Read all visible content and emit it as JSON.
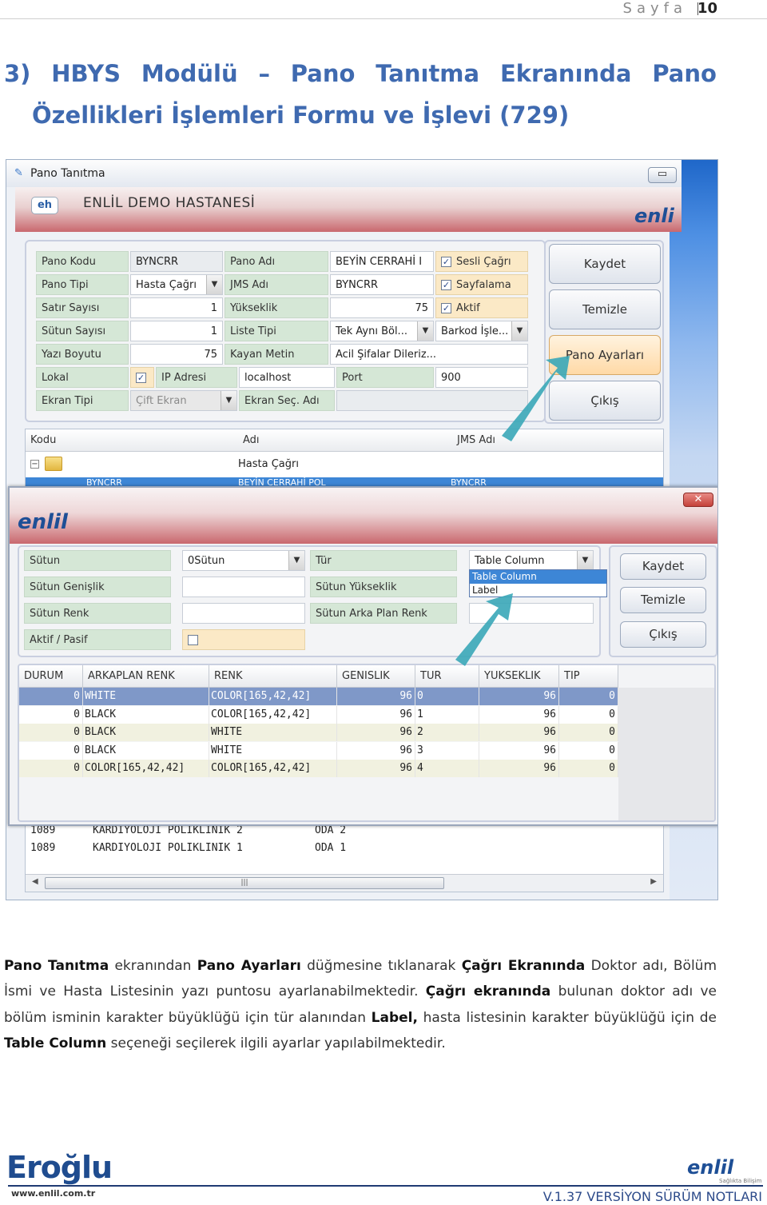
{
  "page": {
    "label": "Sayfa",
    "number": "10"
  },
  "heading": {
    "line1": [
      "3)",
      "HBYS",
      "Modülü",
      "–",
      "Pano",
      "Tanıtma",
      "Ekranında",
      "Pano"
    ],
    "line2": "Özellikleri İşlemleri Formu ve İşlevi (729)"
  },
  "screenshot": {
    "window_title": "Pano Tanıtma",
    "min_button": "▭",
    "banner": {
      "badge": "eh",
      "hospital": "ENLİL DEMO HASTANESİ",
      "logo": "enli"
    },
    "form": {
      "pano_kodu_label": "Pano Kodu",
      "pano_kodu": "BYNCRR",
      "pano_adi_label": "Pano Adı",
      "pano_adi": "BEYİN CERRAHİ I",
      "sesli_cagri": "Sesli Çağrı",
      "pano_tipi_label": "Pano Tipi",
      "pano_tipi": "Hasta Çağrı",
      "jms_adi_label": "JMS Adı",
      "jms_adi": "BYNCRR",
      "sayfalama": "Sayfalama",
      "satir_sayisi_label": "Satır Sayısı",
      "satir_sayisi": "1",
      "yukseklik_label": "Yükseklik",
      "yukseklik": "75",
      "aktif": "Aktif",
      "sutun_sayisi_label": "Sütun Sayısı",
      "sutun_sayisi": "1",
      "liste_tipi_label": "Liste Tipi",
      "liste_tipi": "Tek Aynı Böl...",
      "barkod": "Barkod İşle...",
      "yazi_boyutu_label": "Yazı Boyutu",
      "yazi_boyutu": "75",
      "kayan_metin_label": "Kayan Metin",
      "kayan_metin": "Acil Şifalar Dileriz...",
      "lokal_label": "Lokal",
      "ip_adresi_label": "IP Adresi",
      "ip_adresi": "localhost",
      "port_label": "Port",
      "port": "900",
      "ekran_tipi_label": "Ekran Tipi",
      "ekran_tipi": "Çift Ekran",
      "ekran_sec_adi_label": "Ekran Seç. Adı"
    },
    "buttons": {
      "kaydet": "Kaydet",
      "temizle": "Temizle",
      "pano_ayarlari": "Pano Ayarları",
      "cikis": "Çıkış"
    },
    "tree": {
      "headers": {
        "kodu": "Kodu",
        "adi": "Adı",
        "jms_adi": "JMS Adı"
      },
      "group": "Hasta Çağrı",
      "selected": {
        "kodu": "BYNCRR",
        "adi": "BEYİN CERRAHİ POL",
        "jms": "BYNCRR"
      },
      "rows": [
        {
          "kodu": "1089",
          "adi": "KARDIYOLOJI POLIKLINIK 2",
          "jms": "ODA 2"
        },
        {
          "kodu": "1089",
          "adi": "KARDIYOLOJI POLIKLINIK 1",
          "jms": "ODA 1"
        }
      ],
      "scroll_grip": "|||"
    },
    "dialog": {
      "logo": "enlil",
      "close": "✕",
      "sutun_label": "Sütun",
      "sutun": "0Sütun",
      "tur_label": "Tür",
      "tur": "Table Column",
      "sutun_genislik_label": "Sütun Genişlik",
      "sutun_yukseklik_label": "Sütun Yükseklik",
      "sutun_renk_label": "Sütun Renk",
      "sutun_arka_plan_renk_label": "Sütun Arka Plan Renk",
      "aktif_pasif_label": "Aktif / Pasif",
      "tur_options": [
        "Table Column",
        "Label"
      ],
      "buttons": {
        "kaydet": "Kaydet",
        "temizle": "Temizle",
        "cikis": "Çıkış"
      },
      "grid": {
        "headers": [
          "DURUM",
          "ARKAPLAN RENK",
          "RENK",
          "GENISLIK",
          "TUR",
          "YUKSEKLIK",
          "TIP"
        ],
        "rows": [
          [
            "0",
            "WHITE",
            "COLOR[165,42,42]",
            "96",
            "0",
            "96",
            "0"
          ],
          [
            "0",
            "BLACK",
            "COLOR[165,42,42]",
            "96",
            "1",
            "96",
            "0"
          ],
          [
            "0",
            "BLACK",
            "WHITE",
            "96",
            "2",
            "96",
            "0"
          ],
          [
            "0",
            "BLACK",
            "WHITE",
            "96",
            "3",
            "96",
            "0"
          ],
          [
            "0",
            "COLOR[165,42,42]",
            "COLOR[165,42,42]",
            "96",
            "4",
            "96",
            "0"
          ]
        ]
      }
    }
  },
  "body_segments": [
    {
      "t": "Pano Tanıtma",
      "b": true
    },
    {
      "t": " ekranından ",
      "b": false
    },
    {
      "t": "Pano Ayarları",
      "b": true
    },
    {
      "t": " düğmesine tıklanarak ",
      "b": false
    },
    {
      "t": "Çağrı Ekranında",
      "b": true
    },
    {
      "t": " Doktor adı, Bölüm İsmi ve Hasta Listesinin yazı puntosu ayarlanabilmektedir. ",
      "b": false
    },
    {
      "t": "Çağrı ekranında",
      "b": true
    },
    {
      "t": " bulunan doktor adı ve bölüm isminin karakter büyüklüğü için tür alanından ",
      "b": false
    },
    {
      "t": "Label,",
      "b": true
    },
    {
      "t": " hasta listesinin karakter büyüklüğü için de ",
      "b": false
    },
    {
      "t": "Table Column",
      "b": true
    },
    {
      "t": " seçeneği seçilerek ilgili ayarlar yapılabilmektedir.",
      "b": false
    }
  ],
  "footer": {
    "company": "Eroğlu",
    "url": "www.enlil.com.tr",
    "brand": "enlil",
    "brand_sub": "Sağlıkta Bilişim",
    "version": "V.1.37 VERSİYON SÜRÜM NOTLARI"
  },
  "colors": {
    "heading": "#3f6ab0",
    "arrow": "#3aa7b8",
    "selection": "#3d86d6"
  }
}
